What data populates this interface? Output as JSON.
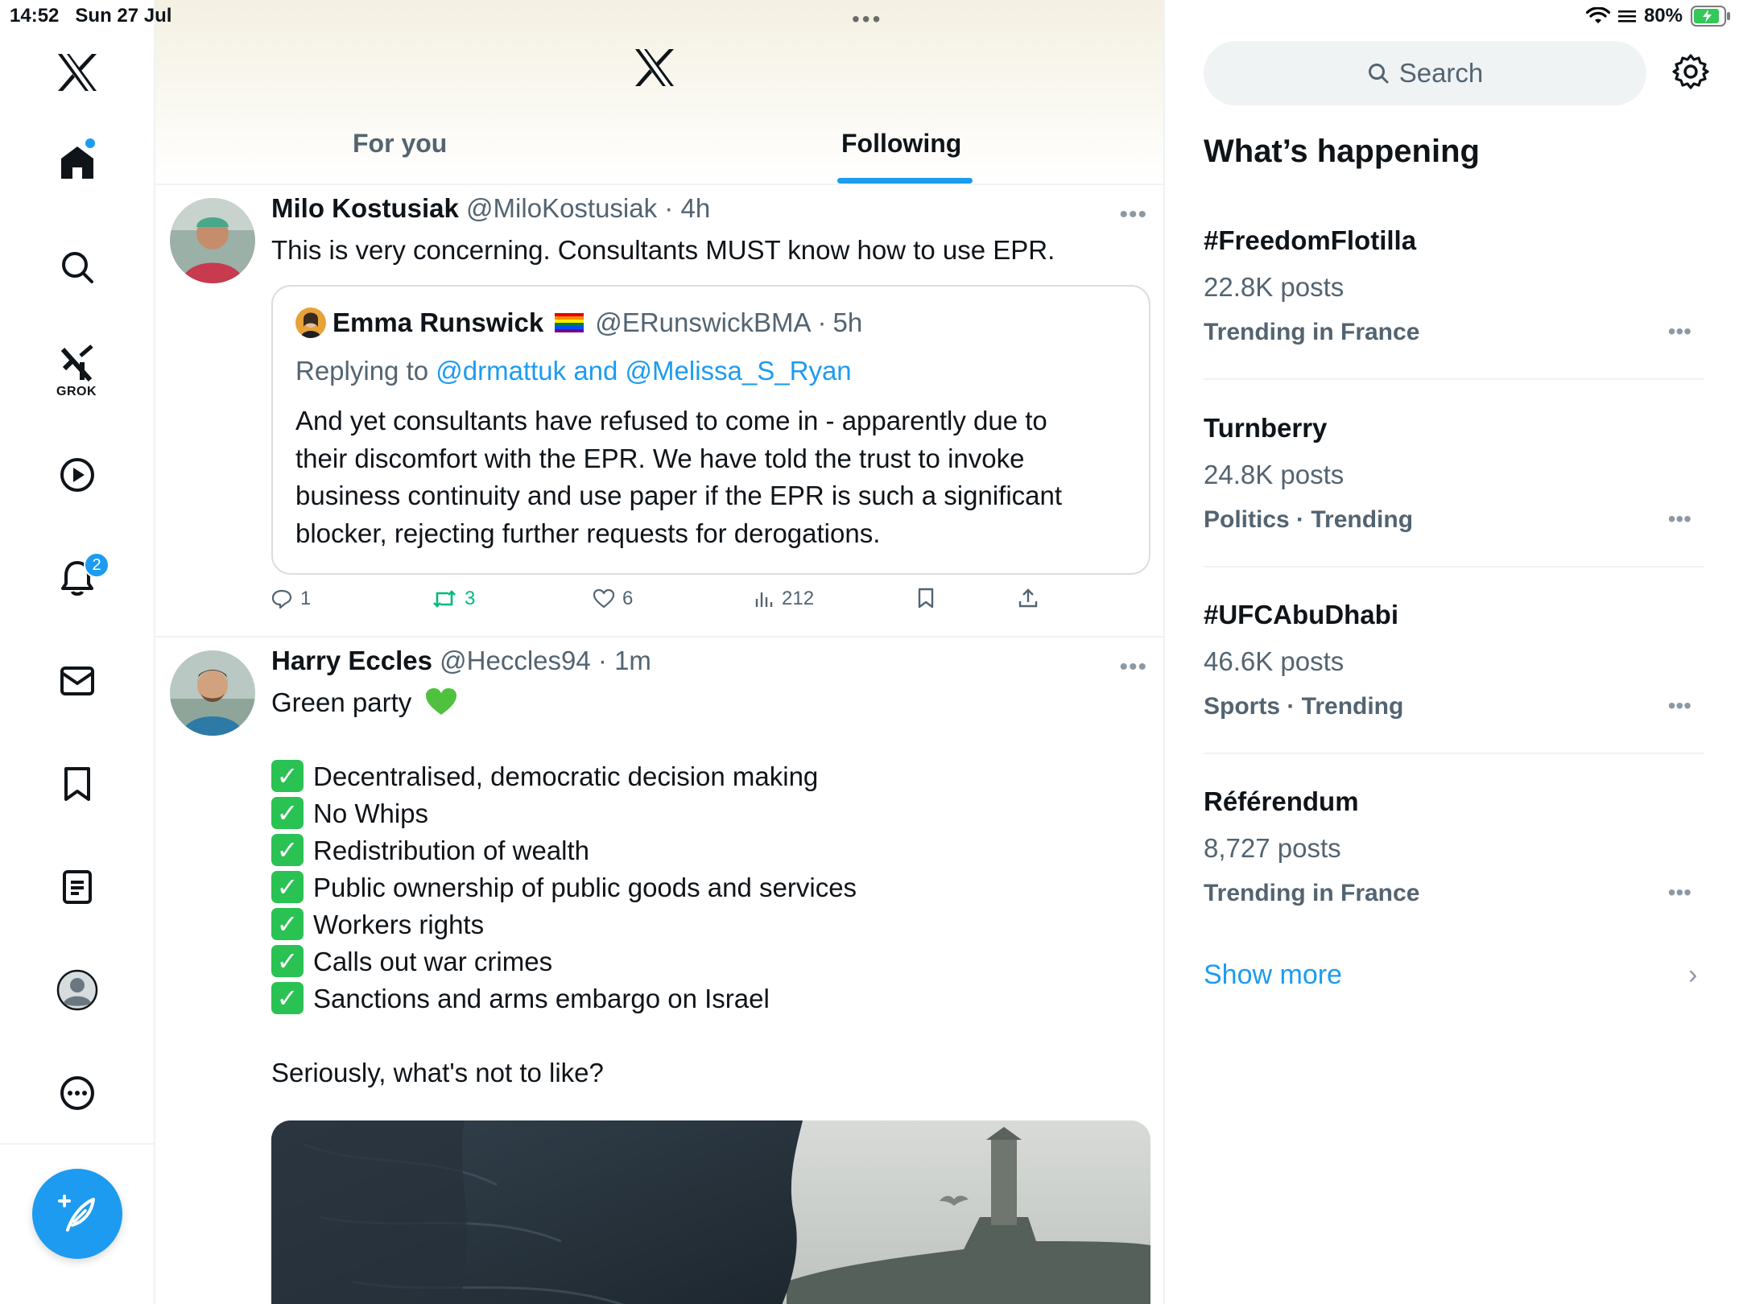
{
  "status_bar": {
    "time": "14:52",
    "date": "Sun 27 Jul",
    "battery": "80%"
  },
  "nav": {
    "grok_label": "GROK",
    "notifications_badge": "2"
  },
  "header": {
    "tabs": [
      {
        "label": "For you"
      },
      {
        "label": "Following"
      }
    ]
  },
  "posts": [
    {
      "name": "Milo Kostusiak",
      "handle": "@MiloKostusiak",
      "time": "4h",
      "text": "This is very concerning. Consultants MUST know how to use EPR.",
      "quote": {
        "name": "Emma Runswick",
        "handle": "@ERunswickBMA",
        "time": "5h",
        "replying_prefix": "Replying to",
        "replying_to": "@drmattuk and @Melissa_S_Ryan",
        "lines": [
          "And yet consultants have refused to come in - apparently due to",
          "their discomfort with the EPR. We have told the trust to invoke",
          "business continuity and use paper if the EPR is such a significant",
          "blocker, rejecting further requests for derogations."
        ]
      },
      "stats": {
        "replies": "1",
        "reposts": "3",
        "likes": "6",
        "views": "212"
      }
    },
    {
      "name": "Harry Eccles",
      "handle": "@Heccles94",
      "time": "1m",
      "intro": "Green party",
      "items": [
        "Decentralised, democratic decision making",
        "No Whips",
        "Redistribution of wealth",
        "Public ownership of public goods and services",
        "Workers rights",
        "Calls out war crimes",
        "Sanctions and arms embargo on Israel"
      ],
      "outro": "Seriously, what's not to like?"
    }
  ],
  "sidebar": {
    "search_placeholder": "Search",
    "title": "What’s happening",
    "trends": [
      {
        "name": "#FreedomFlotilla",
        "count": "22.8K posts",
        "context": "Trending in France"
      },
      {
        "name": "Turnberry",
        "count": "24.8K posts",
        "context": "Politics · Trending"
      },
      {
        "name": "#UFCAbuDhabi",
        "count": "46.6K posts",
        "context": "Sports · Trending"
      },
      {
        "name": "Référendum",
        "count": "8,727 posts",
        "context": "Trending in France"
      }
    ],
    "show_more": "Show more"
  },
  "colors": {
    "accent": "#1d9bf0",
    "repost_green": "#00ba7c",
    "check_green": "#2ac253",
    "muted_text": "#536471"
  },
  "icons": [
    "x-logo-icon",
    "home-icon",
    "search-icon",
    "grok-icon",
    "video-icon",
    "bell-icon",
    "mail-icon",
    "bookmark-icon",
    "list-icon",
    "profile-icon",
    "more-icon",
    "compose-icon",
    "gear-icon",
    "wifi-icon",
    "battery-icon"
  ]
}
